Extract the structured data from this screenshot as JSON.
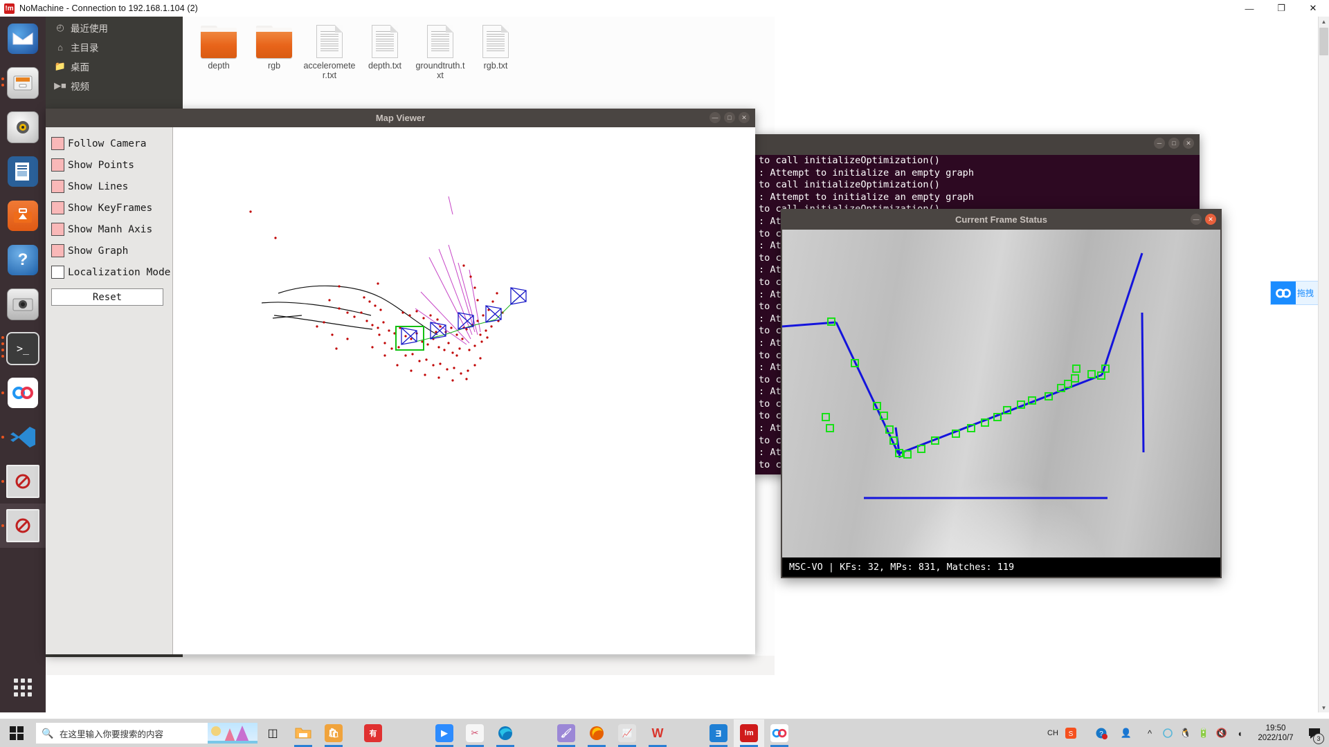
{
  "window": {
    "title": "NoMachine - Connection to 192.168.1.104 (2)",
    "icon": "nomachine-icon",
    "minimize": "—",
    "maximize": "❐",
    "close": "✕"
  },
  "dock": {
    "items": [
      {
        "name": "thunderbird",
        "glyph": "✉",
        "color": "#2a5db0",
        "running": false
      },
      {
        "name": "files",
        "glyph": "὜4",
        "color": "#b9b9b9",
        "running": true
      },
      {
        "name": "rhythmbox",
        "glyph": "♫",
        "color": "#c9c6c0",
        "running": false
      },
      {
        "name": "libreoffice-writer",
        "glyph": "Ὄ4",
        "color": "#2a6099",
        "running": false
      },
      {
        "name": "ubuntu-software",
        "glyph": "A",
        "color": "#e95420",
        "running": false
      },
      {
        "name": "help",
        "glyph": "?",
        "color": "#3a76c4",
        "running": false
      },
      {
        "name": "cheese-camera",
        "glyph": "὏7",
        "color": "#a9a9a9",
        "running": false
      },
      {
        "name": "terminal",
        "glyph": ">_",
        "color": "#3b3b3b",
        "running": true
      },
      {
        "name": "baidu-netdisk",
        "glyph": "⚯",
        "color": "#ffffff",
        "running": true
      },
      {
        "name": "vscode",
        "glyph": "⬅",
        "color": "#1d78c1",
        "running": true
      },
      {
        "name": "blocked-app-1",
        "glyph": "⛔",
        "color": "#d8d8d8",
        "running": true
      },
      {
        "name": "blocked-app-2",
        "glyph": "⛔",
        "color": "#d8d8d8",
        "running": true
      }
    ],
    "show_apps": "show-applications"
  },
  "file_manager": {
    "sidebar": [
      {
        "label": "最近使用",
        "icon": "clock-icon"
      },
      {
        "label": "主目录",
        "icon": "home-icon"
      },
      {
        "label": "桌面",
        "icon": "folder-icon"
      },
      {
        "label": "视频",
        "icon": "video-icon"
      }
    ],
    "files": [
      {
        "name": "depth",
        "type": "folder"
      },
      {
        "name": "rgb",
        "type": "folder"
      },
      {
        "name": "accelerometer.txt",
        "type": "document"
      },
      {
        "name": "depth.txt",
        "type": "document"
      },
      {
        "name": "groundtruth.txt",
        "type": "document"
      },
      {
        "name": "rgb.txt",
        "type": "document"
      }
    ]
  },
  "map_viewer": {
    "title": "Map Viewer",
    "minimize": "—",
    "maximize": "□",
    "close": "✕",
    "checkboxes": [
      {
        "label": "Follow Camera",
        "checked": true
      },
      {
        "label": "Show Points",
        "checked": true
      },
      {
        "label": "Show Lines",
        "checked": true
      },
      {
        "label": "Show KeyFrames",
        "checked": true
      },
      {
        "label": "Show Manh Axis",
        "checked": true
      },
      {
        "label": "Show Graph",
        "checked": true
      },
      {
        "label": "Localization Mode",
        "checked": false
      }
    ],
    "reset_label": "Reset"
  },
  "terminal": {
    "lines": [
      "to call initializeOptimization()",
      ": Attempt to initialize an empty graph",
      "to call initializeOptimization()",
      ": Attempt to initialize an empty graph",
      "to call initializeOptimization()",
      ": Attempt to initialize an empty graph",
      "to call initializeOptimization()",
      ": Attempt to initialize an empty graph",
      "to call initializeOptimization()",
      ": Attempt to initialize an empty graph",
      "to call initializeOptimization()",
      ": Attempt to initialize an empty graph",
      "to call initializeOptimization()",
      ": Attempt to initialize an empty graph",
      "to call initializeOptimization()",
      ": Attempt to initialize an empty graph",
      "to call initializeOptimization()",
      ": Attempt to initialize an empty graph",
      "to call initializeOptimization()",
      ": Attempt to initialize an empty graph",
      "to call initializeOptimization()",
      "to call initializeOptimization()",
      ": Attempt to initialize an empty graph",
      "to call initializeOptimization()",
      ": Attempt to initialize an empty graph",
      "to call initializeOptimization()"
    ]
  },
  "frame_status": {
    "title": "Current Frame Status",
    "minimize": "—",
    "close": "✕",
    "status": "MSC-VO |  KFs: 32, MPs: 831, Matches: 119",
    "stats": {
      "kfs": 32,
      "mps": 831,
      "matches": 119,
      "system": "MSC-VO"
    }
  },
  "baidu_widget": {
    "icon": "baidu-netdisk-icon",
    "label": "拖拽"
  },
  "taskbar": {
    "start": "start-button",
    "search_placeholder": "在这里输入你要搜索的内容",
    "search_icon": "search-icon",
    "task_view": "task-view-icon",
    "pinned": [
      {
        "name": "file-explorer",
        "glyph": "Ὄ1",
        "color": "#ffb64d",
        "running": true,
        "active": false
      },
      {
        "name": "store",
        "glyph": "ὬD",
        "color": "#f0a33c",
        "running": true,
        "active": false
      },
      {
        "name": "youdao-dict",
        "glyph": "有",
        "color": "#e03131",
        "running": false,
        "active": false
      },
      {
        "name": "zoom-meeting",
        "glyph": "Ἲ5",
        "color": "#2d8cff",
        "running": true,
        "active": false
      },
      {
        "name": "snipaste",
        "glyph": "✂",
        "color": "#f0f0f0",
        "running": true,
        "active": false
      },
      {
        "name": "microsoft-edge",
        "glyph": "e",
        "color": "#0f7cc0",
        "running": true,
        "active": false
      },
      {
        "name": "painting-app",
        "glyph": "὘C",
        "color": "#9b87d6",
        "running": true,
        "active": false
      },
      {
        "name": "firefox",
        "glyph": "ᾘA",
        "color": "#e66000",
        "running": true,
        "active": false
      },
      {
        "name": "origin-plot",
        "glyph": "Ὄ8",
        "color": "#c3c3c3",
        "running": true,
        "active": false
      },
      {
        "name": "wps-office",
        "glyph": "W",
        "color": "#d9342b",
        "running": true,
        "active": false
      },
      {
        "name": "edraw",
        "glyph": "Ǝ",
        "color": "#1f7fd4",
        "running": true,
        "active": false
      },
      {
        "name": "nomachine",
        "glyph": "!m",
        "color": "#cf1b1b",
        "running": true,
        "active": true
      },
      {
        "name": "baidu-netdisk",
        "glyph": "⚯",
        "color": "#ffffff",
        "running": true,
        "active": false
      }
    ],
    "tray": [
      {
        "name": "ime-indicator",
        "glyph": "CH"
      },
      {
        "name": "sogou-input",
        "glyph": "S"
      },
      {
        "name": "help-alert",
        "glyph": "?"
      },
      {
        "name": "people",
        "glyph": "὆4"
      },
      {
        "name": "show-hidden-icons",
        "glyph": "∧"
      },
      {
        "name": "onedrive",
        "glyph": "☁"
      },
      {
        "name": "qq",
        "glyph": "ὂ7"
      },
      {
        "name": "battery",
        "glyph": "ὐB"
      },
      {
        "name": "volume-muted",
        "glyph": "ὐ7"
      },
      {
        "name": "network-wifi",
        "glyph": "◠"
      }
    ],
    "clock": {
      "time": "19:50",
      "date": "2022/10/7"
    },
    "notifications": {
      "icon": "notification-icon",
      "count": "3"
    }
  }
}
